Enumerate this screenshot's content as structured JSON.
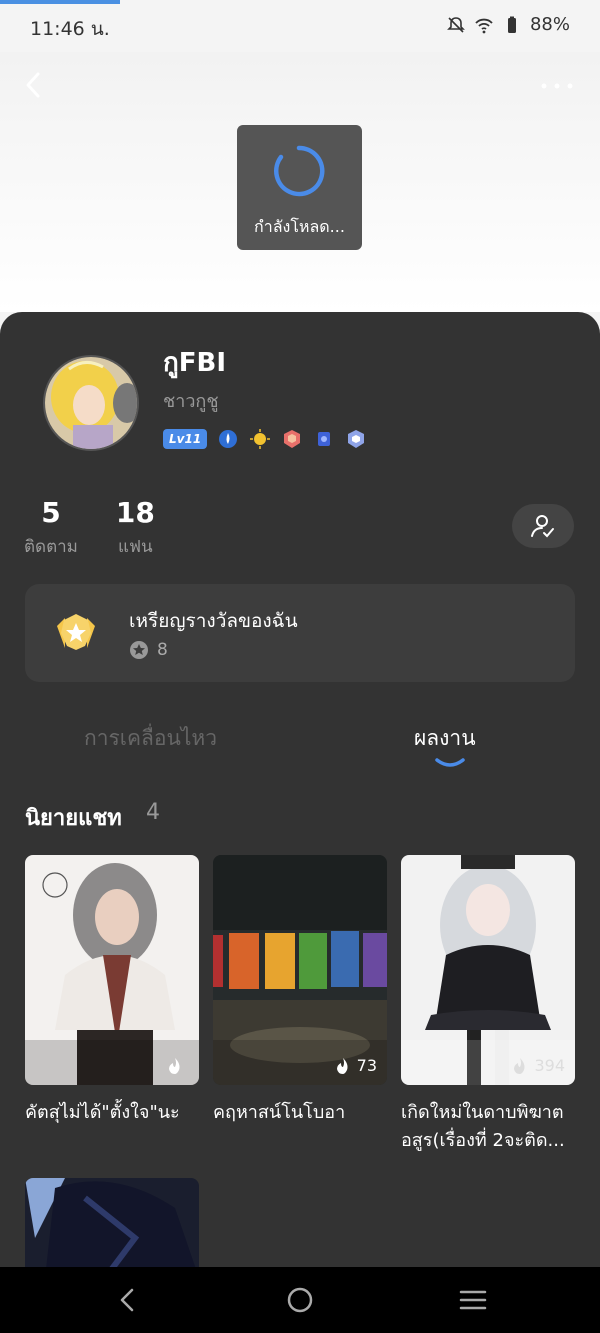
{
  "status_bar": {
    "time": "11:46 น.",
    "battery": "88%"
  },
  "loading": {
    "text": "กำลังโหลด..."
  },
  "profile": {
    "name": "กูFBI",
    "subtitle": "ชาวกูชู",
    "level": "Lv11"
  },
  "stats": [
    {
      "value": "5",
      "label": "ติดตาม"
    },
    {
      "value": "18",
      "label": "แฟน"
    }
  ],
  "medals": {
    "title": "เหรียญรางวัลของฉัน",
    "count": "8"
  },
  "tabs": {
    "activity": "การเคลื่อนไหว",
    "works": "ผลงาน"
  },
  "section": {
    "title": "นิยายแชท",
    "count": "4"
  },
  "stories": [
    {
      "title": "คัตสุไม่ได้\"ตั้งใจ\"นะ",
      "views": ""
    },
    {
      "title": "คฤหาสน์โนโบอา",
      "views": "73"
    },
    {
      "title": "เกิดใหม่ในดาบพิฆาตอสูร(เรื่องที่ 2จะติด...",
      "views": "394"
    }
  ],
  "colors": {
    "accent": "#4a8be8",
    "sheet": "#333333"
  }
}
